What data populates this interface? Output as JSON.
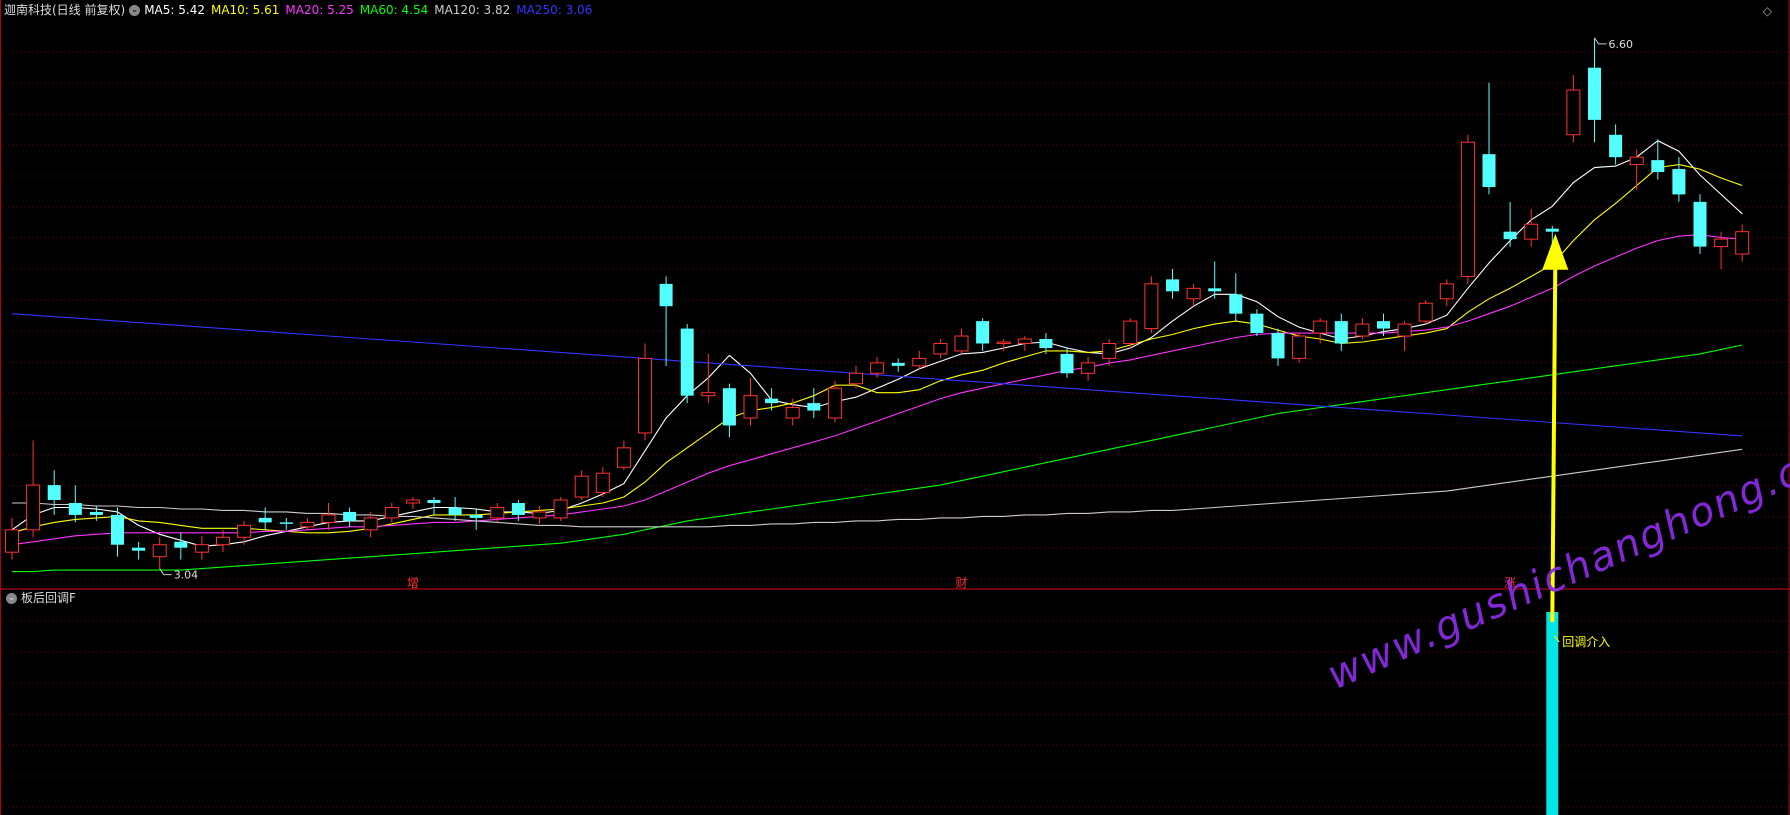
{
  "header": {
    "title": "迦南科技(日线 前复权)",
    "indicator_icon": "chevron-circle-icon",
    "ma": [
      {
        "label": "MA5:",
        "value": "5.42",
        "color": "#ffffff"
      },
      {
        "label": "MA10:",
        "value": "5.61",
        "color": "#ffff00"
      },
      {
        "label": "MA20:",
        "value": "5.25",
        "color": "#ff33ff"
      },
      {
        "label": "MA60:",
        "value": "4.54",
        "color": "#00ff00"
      },
      {
        "label": "MA120:",
        "value": "3.82",
        "color": "#cccccc"
      },
      {
        "label": "MA250:",
        "value": "3.06",
        "color": "#3333ff"
      }
    ],
    "right_icon": "diamond-icon"
  },
  "sub_panel": {
    "title": "板后回调F",
    "signal_label": "回调介入",
    "signal_color": "#00e5e5"
  },
  "events": [
    "增",
    "财",
    "涨"
  ],
  "watermark": "www.gushichanghong.com",
  "chart_data": {
    "type": "candlestick",
    "high_label": "6.60",
    "low_label": "3.04",
    "ylim": [
      2.95,
      6.72
    ],
    "up_color": "#ff3232",
    "down_color": "#54ffff",
    "candles": [
      [
        3.15,
        3.3,
        3.38,
        3.1
      ],
      [
        3.3,
        3.6,
        3.9,
        3.25
      ],
      [
        3.6,
        3.5,
        3.7,
        3.4
      ],
      [
        3.48,
        3.4,
        3.6,
        3.35
      ],
      [
        3.42,
        3.4,
        3.46,
        3.36
      ],
      [
        3.4,
        3.2,
        3.45,
        3.12
      ],
      [
        3.18,
        3.16,
        3.22,
        3.1
      ],
      [
        3.12,
        3.2,
        3.25,
        3.04
      ],
      [
        3.22,
        3.18,
        3.28,
        3.1
      ],
      [
        3.15,
        3.2,
        3.26,
        3.1
      ],
      [
        3.2,
        3.25,
        3.3,
        3.15
      ],
      [
        3.25,
        3.33,
        3.36,
        3.2
      ],
      [
        3.38,
        3.35,
        3.45,
        3.3
      ],
      [
        3.35,
        3.34,
        3.38,
        3.3
      ],
      [
        3.32,
        3.35,
        3.38,
        3.3
      ],
      [
        3.35,
        3.4,
        3.48,
        3.3
      ],
      [
        3.42,
        3.36,
        3.45,
        3.32
      ],
      [
        3.3,
        3.38,
        3.42,
        3.25
      ],
      [
        3.38,
        3.45,
        3.48,
        3.35
      ],
      [
        3.48,
        3.5,
        3.52,
        3.44
      ],
      [
        3.5,
        3.48,
        3.52,
        3.4
      ],
      [
        3.45,
        3.4,
        3.52,
        3.36
      ],
      [
        3.4,
        3.38,
        3.44,
        3.3
      ],
      [
        3.38,
        3.45,
        3.48,
        3.35
      ],
      [
        3.48,
        3.4,
        3.5,
        3.36
      ],
      [
        3.38,
        3.42,
        3.46,
        3.34
      ],
      [
        3.38,
        3.5,
        3.52,
        3.36
      ],
      [
        3.52,
        3.66,
        3.7,
        3.5
      ],
      [
        3.55,
        3.68,
        3.72,
        3.52
      ],
      [
        3.72,
        3.85,
        3.9,
        3.7
      ],
      [
        3.95,
        4.45,
        4.55,
        3.9
      ],
      [
        4.95,
        4.8,
        5.0,
        4.4
      ],
      [
        4.65,
        4.2,
        4.68,
        4.15
      ],
      [
        4.2,
        4.22,
        4.48,
        4.15
      ],
      [
        4.25,
        4.0,
        4.28,
        3.92
      ],
      [
        4.05,
        4.2,
        4.32,
        4.0
      ],
      [
        4.18,
        4.15,
        4.25,
        4.1
      ],
      [
        4.05,
        4.12,
        4.18,
        4.0
      ],
      [
        4.15,
        4.1,
        4.25,
        4.05
      ],
      [
        4.05,
        4.25,
        4.3,
        4.02
      ],
      [
        4.28,
        4.35,
        4.4,
        4.25
      ],
      [
        4.35,
        4.42,
        4.46,
        4.32
      ],
      [
        4.42,
        4.4,
        4.45,
        4.36
      ],
      [
        4.4,
        4.45,
        4.5,
        4.38
      ],
      [
        4.48,
        4.55,
        4.58,
        4.45
      ],
      [
        4.5,
        4.6,
        4.65,
        4.48
      ],
      [
        4.7,
        4.55,
        4.72,
        4.5
      ],
      [
        4.55,
        4.56,
        4.58,
        4.5
      ],
      [
        4.55,
        4.58,
        4.6,
        4.5
      ],
      [
        4.58,
        4.52,
        4.62,
        4.48
      ],
      [
        4.48,
        4.35,
        4.52,
        4.32
      ],
      [
        4.35,
        4.42,
        4.46,
        4.3
      ],
      [
        4.45,
        4.55,
        4.58,
        4.4
      ],
      [
        4.55,
        4.7,
        4.72,
        4.52
      ],
      [
        4.65,
        4.95,
        5.0,
        4.62
      ],
      [
        4.98,
        4.9,
        5.05,
        4.85
      ],
      [
        4.85,
        4.92,
        4.95,
        4.8
      ],
      [
        4.92,
        4.9,
        5.1,
        4.85
      ],
      [
        4.88,
        4.75,
        5.02,
        4.7
      ],
      [
        4.75,
        4.62,
        4.78,
        4.6
      ],
      [
        4.62,
        4.45,
        4.65,
        4.4
      ],
      [
        4.45,
        4.6,
        4.62,
        4.42
      ],
      [
        4.62,
        4.7,
        4.72,
        4.55
      ],
      [
        4.7,
        4.55,
        4.75,
        4.5
      ],
      [
        4.6,
        4.68,
        4.72,
        4.58
      ],
      [
        4.7,
        4.65,
        4.75,
        4.6
      ],
      [
        4.6,
        4.68,
        4.7,
        4.5
      ],
      [
        4.7,
        4.82,
        4.84,
        4.68
      ],
      [
        4.85,
        4.95,
        4.98,
        4.8
      ],
      [
        5.0,
        5.9,
        5.95,
        4.95
      ],
      [
        5.82,
        5.6,
        6.3,
        5.55
      ],
      [
        5.3,
        5.25,
        5.5,
        5.2
      ],
      [
        5.25,
        5.35,
        5.45,
        5.2
      ],
      [
        5.32,
        5.3,
        5.34,
        5.18
      ],
      [
        5.95,
        6.25,
        6.35,
        5.9
      ],
      [
        6.4,
        6.05,
        6.6,
        5.9
      ],
      [
        5.95,
        5.8,
        6.02,
        5.75
      ],
      [
        5.75,
        5.8,
        5.85,
        5.58
      ],
      [
        5.78,
        5.7,
        5.92,
        5.65
      ],
      [
        5.72,
        5.55,
        5.8,
        5.5
      ],
      [
        5.5,
        5.2,
        5.55,
        5.15
      ],
      [
        5.2,
        5.25,
        5.3,
        5.05
      ],
      [
        5.15,
        5.3,
        5.35,
        5.1
      ]
    ],
    "moving_averages": [
      {
        "name": "MA5",
        "color": "#ffffff",
        "values": [
          3.3,
          3.4,
          3.45,
          3.45,
          3.44,
          3.42,
          3.33,
          3.27,
          3.23,
          3.19,
          3.2,
          3.22,
          3.26,
          3.29,
          3.32,
          3.35,
          3.36,
          3.36,
          3.39,
          3.42,
          3.45,
          3.45,
          3.44,
          3.42,
          3.42,
          3.41,
          3.43,
          3.48,
          3.54,
          3.61,
          3.83,
          4.05,
          4.2,
          4.32,
          4.47,
          4.35,
          4.17,
          4.14,
          4.12,
          4.16,
          4.19,
          4.25,
          4.31,
          4.38,
          4.43,
          4.48,
          4.49,
          4.52,
          4.55,
          4.56,
          4.52,
          4.49,
          4.48,
          4.52,
          4.59,
          4.7,
          4.8,
          4.88,
          4.88,
          4.83,
          4.73,
          4.66,
          4.62,
          4.58,
          4.6,
          4.63,
          4.65,
          4.68,
          4.74,
          4.92,
          5.09,
          5.24,
          5.38,
          5.47,
          5.63,
          5.73,
          5.74,
          5.8,
          5.91,
          5.84,
          5.68,
          5.55,
          5.42
        ]
      },
      {
        "name": "MA10",
        "color": "#ffff00",
        "values": [
          3.28,
          3.32,
          3.35,
          3.37,
          3.38,
          3.39,
          3.36,
          3.35,
          3.33,
          3.31,
          3.31,
          3.31,
          3.3,
          3.29,
          3.28,
          3.28,
          3.29,
          3.31,
          3.34,
          3.37,
          3.4,
          3.4,
          3.4,
          3.41,
          3.42,
          3.43,
          3.44,
          3.46,
          3.48,
          3.52,
          3.62,
          3.75,
          3.85,
          3.95,
          4.05,
          4.1,
          4.12,
          4.15,
          4.2,
          4.27,
          4.27,
          4.22,
          4.22,
          4.24,
          4.3,
          4.34,
          4.37,
          4.42,
          4.46,
          4.5,
          4.5,
          4.49,
          4.5,
          4.54,
          4.58,
          4.61,
          4.65,
          4.68,
          4.7,
          4.68,
          4.64,
          4.6,
          4.58,
          4.55,
          4.56,
          4.58,
          4.6,
          4.62,
          4.65,
          4.76,
          4.85,
          4.92,
          5.0,
          5.08,
          5.24,
          5.38,
          5.49,
          5.61,
          5.73,
          5.75,
          5.72,
          5.66,
          5.61
        ]
      },
      {
        "name": "MA20",
        "color": "#ff33ff",
        "values": [
          3.2,
          3.22,
          3.24,
          3.26,
          3.27,
          3.28,
          3.28,
          3.28,
          3.28,
          3.28,
          3.28,
          3.28,
          3.29,
          3.29,
          3.3,
          3.31,
          3.32,
          3.32,
          3.33,
          3.34,
          3.35,
          3.35,
          3.36,
          3.37,
          3.38,
          3.39,
          3.4,
          3.42,
          3.44,
          3.46,
          3.5,
          3.56,
          3.62,
          3.68,
          3.73,
          3.77,
          3.81,
          3.85,
          3.89,
          3.93,
          3.98,
          4.03,
          4.08,
          4.13,
          4.18,
          4.22,
          4.25,
          4.28,
          4.31,
          4.34,
          4.37,
          4.39,
          4.42,
          4.44,
          4.47,
          4.5,
          4.53,
          4.56,
          4.59,
          4.61,
          4.62,
          4.62,
          4.62,
          4.62,
          4.62,
          4.62,
          4.63,
          4.64,
          4.66,
          4.7,
          4.75,
          4.8,
          4.86,
          4.92,
          5.0,
          5.07,
          5.13,
          5.19,
          5.24,
          5.27,
          5.28,
          5.26,
          5.25
        ]
      },
      {
        "name": "MA60",
        "color": "#00ff00",
        "values": [
          3.02,
          3.02,
          3.03,
          3.03,
          3.03,
          3.03,
          3.03,
          3.03,
          3.03,
          3.04,
          3.05,
          3.06,
          3.07,
          3.08,
          3.09,
          3.1,
          3.11,
          3.12,
          3.13,
          3.14,
          3.15,
          3.16,
          3.17,
          3.18,
          3.19,
          3.2,
          3.21,
          3.23,
          3.25,
          3.27,
          3.3,
          3.33,
          3.36,
          3.38,
          3.4,
          3.42,
          3.44,
          3.46,
          3.48,
          3.5,
          3.52,
          3.54,
          3.56,
          3.58,
          3.6,
          3.63,
          3.66,
          3.69,
          3.72,
          3.75,
          3.78,
          3.81,
          3.84,
          3.87,
          3.9,
          3.93,
          3.96,
          3.99,
          4.02,
          4.05,
          4.08,
          4.1,
          4.12,
          4.14,
          4.16,
          4.18,
          4.2,
          4.22,
          4.24,
          4.26,
          4.28,
          4.3,
          4.32,
          4.34,
          4.36,
          4.38,
          4.4,
          4.42,
          4.44,
          4.46,
          4.48,
          4.51,
          4.54
        ]
      },
      {
        "name": "MA120",
        "color": "#cccccc",
        "values": [
          3.48,
          3.48,
          3.47,
          3.47,
          3.46,
          3.46,
          3.45,
          3.45,
          3.44,
          3.44,
          3.43,
          3.43,
          3.42,
          3.42,
          3.41,
          3.41,
          3.4,
          3.4,
          3.39,
          3.39,
          3.38,
          3.37,
          3.36,
          3.35,
          3.34,
          3.33,
          3.33,
          3.32,
          3.32,
          3.32,
          3.32,
          3.32,
          3.32,
          3.32,
          3.33,
          3.33,
          3.34,
          3.34,
          3.35,
          3.35,
          3.36,
          3.36,
          3.37,
          3.37,
          3.38,
          3.38,
          3.39,
          3.39,
          3.4,
          3.4,
          3.41,
          3.41,
          3.42,
          3.42,
          3.43,
          3.43,
          3.44,
          3.45,
          3.46,
          3.47,
          3.48,
          3.49,
          3.5,
          3.51,
          3.52,
          3.53,
          3.54,
          3.55,
          3.56,
          3.58,
          3.6,
          3.62,
          3.64,
          3.66,
          3.68,
          3.7,
          3.72,
          3.74,
          3.76,
          3.78,
          3.8,
          3.82,
          3.84
        ]
      },
      {
        "name": "MA250",
        "color": "#3333ff",
        "values": [
          4.75,
          4.74,
          4.73,
          4.72,
          4.71,
          4.7,
          4.69,
          4.68,
          4.67,
          4.66,
          4.65,
          4.64,
          4.63,
          4.62,
          4.61,
          4.6,
          4.59,
          4.58,
          4.57,
          4.56,
          4.55,
          4.54,
          4.53,
          4.52,
          4.51,
          4.5,
          4.49,
          4.48,
          4.47,
          4.46,
          4.45,
          4.44,
          4.43,
          4.42,
          4.41,
          4.4,
          4.39,
          4.38,
          4.37,
          4.36,
          4.35,
          4.34,
          4.33,
          4.32,
          4.31,
          4.3,
          4.29,
          4.28,
          4.27,
          4.26,
          4.25,
          4.24,
          4.23,
          4.22,
          4.21,
          4.2,
          4.19,
          4.18,
          4.17,
          4.16,
          4.15,
          4.14,
          4.13,
          4.12,
          4.11,
          4.1,
          4.09,
          4.08,
          4.07,
          4.06,
          4.05,
          4.04,
          4.03,
          4.02,
          4.01,
          4.0,
          3.99,
          3.98,
          3.97,
          3.96,
          3.95,
          3.94,
          3.93
        ]
      }
    ],
    "signal_index": 73,
    "event_indices": [
      19,
      45,
      71
    ]
  }
}
